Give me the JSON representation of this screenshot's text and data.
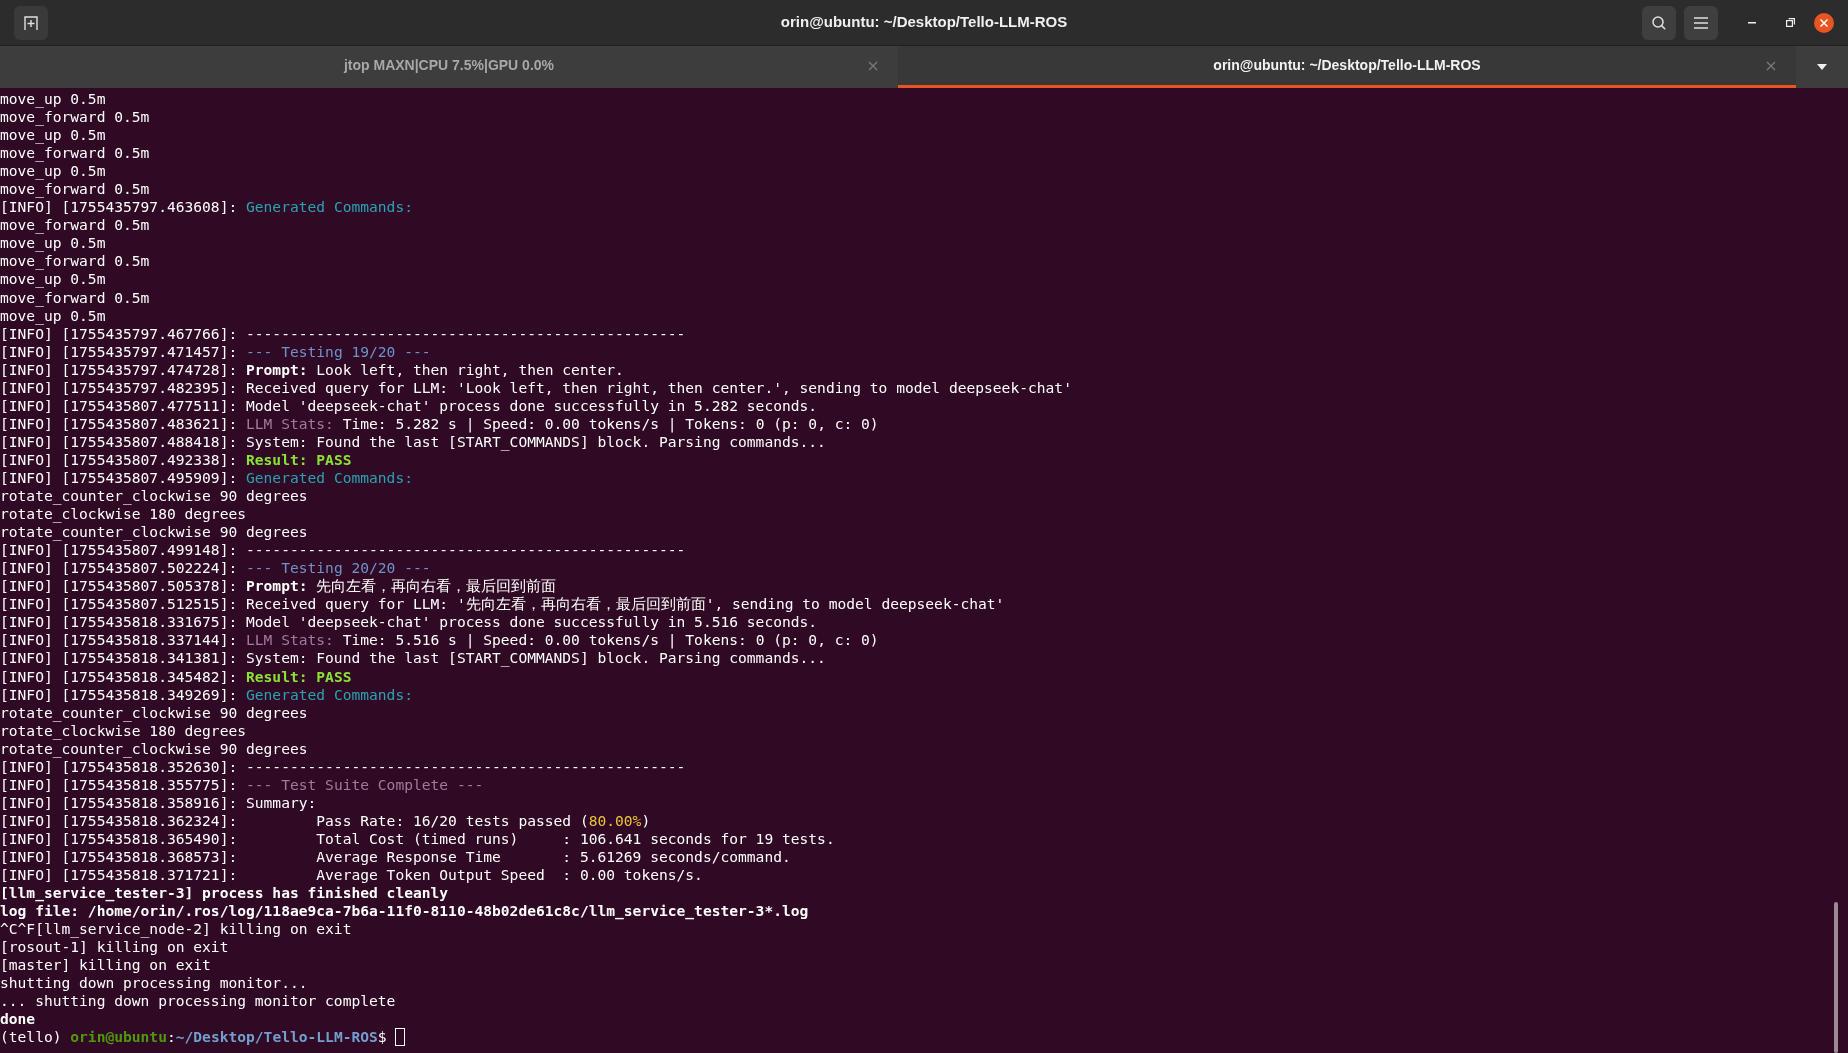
{
  "window": {
    "title": "orin@ubuntu: ~/Desktop/Tello-LLM-ROS"
  },
  "tabs": [
    {
      "label": "jtop MAXN|CPU 7.5%|GPU 0.0%",
      "selected": false
    },
    {
      "label": "orin@ubuntu: ~/Desktop/Tello-LLM-ROS",
      "selected": true
    }
  ],
  "terminal": {
    "lines": [
      [
        {
          "kind": "plain",
          "text": "move_up 0.5m"
        }
      ],
      [
        {
          "kind": "plain",
          "text": "move_forward 0.5m"
        }
      ],
      [
        {
          "kind": "plain",
          "text": "move_up 0.5m"
        }
      ],
      [
        {
          "kind": "plain",
          "text": "move_forward 0.5m"
        }
      ],
      [
        {
          "kind": "plain",
          "text": "move_up 0.5m"
        }
      ],
      [
        {
          "kind": "plain",
          "text": "move_forward 0.5m"
        }
      ],
      [
        {
          "kind": "plain",
          "text": "[INFO] [1755435797.463608]: "
        },
        {
          "kind": "cyan",
          "text": "Generated Commands:"
        }
      ],
      [
        {
          "kind": "plain",
          "text": "move_forward 0.5m"
        }
      ],
      [
        {
          "kind": "plain",
          "text": "move_up 0.5m"
        }
      ],
      [
        {
          "kind": "plain",
          "text": "move_forward 0.5m"
        }
      ],
      [
        {
          "kind": "plain",
          "text": "move_up 0.5m"
        }
      ],
      [
        {
          "kind": "plain",
          "text": "move_forward 0.5m"
        }
      ],
      [
        {
          "kind": "plain",
          "text": "move_up 0.5m"
        }
      ],
      [
        {
          "kind": "plain",
          "text": "[INFO] [1755435797.467766]: --------------------------------------------------"
        }
      ],
      [
        {
          "kind": "plain",
          "text": "[INFO] [1755435797.471457]: "
        },
        {
          "kind": "blue",
          "text": "--- Testing 19/20 ---"
        }
      ],
      [
        {
          "kind": "plain",
          "text": "[INFO] [1755435797.474728]: "
        },
        {
          "kind": "bold",
          "text": "Prompt:"
        },
        {
          "kind": "plain",
          "text": " Look left, then right, then center."
        }
      ],
      [
        {
          "kind": "plain",
          "text": "[INFO] [1755435797.482395]: Received query for LLM: 'Look left, then right, then center.', sending to model deepseek-chat'"
        }
      ],
      [
        {
          "kind": "plain",
          "text": "[INFO] [1755435807.477511]: Model 'deepseek-chat' process done successfully in 5.282 seconds."
        }
      ],
      [
        {
          "kind": "plain",
          "text": "[INFO] [1755435807.483621]: "
        },
        {
          "kind": "mauve",
          "text": "LLM Stats:"
        },
        {
          "kind": "plain",
          "text": " Time: 5.282 s | Speed: 0.00 tokens/s | Tokens: 0 (p: 0, c: 0)"
        }
      ],
      [
        {
          "kind": "plain",
          "text": "[INFO] [1755435807.488418]: System: Found the last [START_COMMANDS] block. Parsing commands..."
        }
      ],
      [
        {
          "kind": "plain",
          "text": "[INFO] [1755435807.492338]: "
        },
        {
          "kind": "green",
          "text": "Result: PASS"
        }
      ],
      [
        {
          "kind": "plain",
          "text": "[INFO] [1755435807.495909]: "
        },
        {
          "kind": "cyan",
          "text": "Generated Commands:"
        }
      ],
      [
        {
          "kind": "plain",
          "text": "rotate_counter_clockwise 90 degrees"
        }
      ],
      [
        {
          "kind": "plain",
          "text": "rotate_clockwise 180 degrees"
        }
      ],
      [
        {
          "kind": "plain",
          "text": "rotate_counter_clockwise 90 degrees"
        }
      ],
      [
        {
          "kind": "plain",
          "text": "[INFO] [1755435807.499148]: --------------------------------------------------"
        }
      ],
      [
        {
          "kind": "plain",
          "text": "[INFO] [1755435807.502224]: "
        },
        {
          "kind": "blue",
          "text": "--- Testing 20/20 ---"
        }
      ],
      [
        {
          "kind": "plain",
          "text": "[INFO] [1755435807.505378]: "
        },
        {
          "kind": "bold",
          "text": "Prompt:"
        },
        {
          "kind": "plain",
          "text": " 先向左看，再向右看，最后回到前面"
        }
      ],
      [
        {
          "kind": "plain",
          "text": "[INFO] [1755435807.512515]: Received query for LLM: '先向左看，再向右看，最后回到前面', sending to model deepseek-chat'"
        }
      ],
      [
        {
          "kind": "plain",
          "text": "[INFO] [1755435818.331675]: Model 'deepseek-chat' process done successfully in 5.516 seconds."
        }
      ],
      [
        {
          "kind": "plain",
          "text": "[INFO] [1755435818.337144]: "
        },
        {
          "kind": "mauve",
          "text": "LLM Stats:"
        },
        {
          "kind": "plain",
          "text": " Time: 5.516 s | Speed: 0.00 tokens/s | Tokens: 0 (p: 0, c: 0)"
        }
      ],
      [
        {
          "kind": "plain",
          "text": "[INFO] [1755435818.341381]: System: Found the last [START_COMMANDS] block. Parsing commands..."
        }
      ],
      [
        {
          "kind": "plain",
          "text": "[INFO] [1755435818.345482]: "
        },
        {
          "kind": "green",
          "text": "Result: PASS"
        }
      ],
      [
        {
          "kind": "plain",
          "text": "[INFO] [1755435818.349269]: "
        },
        {
          "kind": "cyan",
          "text": "Generated Commands:"
        }
      ],
      [
        {
          "kind": "plain",
          "text": "rotate_counter_clockwise 90 degrees"
        }
      ],
      [
        {
          "kind": "plain",
          "text": "rotate_clockwise 180 degrees"
        }
      ],
      [
        {
          "kind": "plain",
          "text": "rotate_counter_clockwise 90 degrees"
        }
      ],
      [
        {
          "kind": "plain",
          "text": "[INFO] [1755435818.352630]: --------------------------------------------------"
        }
      ],
      [
        {
          "kind": "plain",
          "text": "[INFO] [1755435818.355775]: "
        },
        {
          "kind": "mauve",
          "text": "--- Test Suite Complete ---"
        }
      ],
      [
        {
          "kind": "plain",
          "text": "[INFO] [1755435818.358916]: Summary:"
        }
      ],
      [
        {
          "kind": "plain",
          "text": "[INFO] [1755435818.362324]:         Pass Rate: 16/20 tests passed ("
        },
        {
          "kind": "yellow",
          "text": "80.00%"
        },
        {
          "kind": "plain",
          "text": ")"
        }
      ],
      [
        {
          "kind": "plain",
          "text": "[INFO] [1755435818.365490]:         Total Cost (timed runs)     : 106.641 seconds for 19 tests."
        }
      ],
      [
        {
          "kind": "plain",
          "text": "[INFO] [1755435818.368573]:         Average Response Time       : 5.61269 seconds/command."
        }
      ],
      [
        {
          "kind": "plain",
          "text": "[INFO] [1755435818.371721]:         Average Token Output Speed  : 0.00 tokens/s."
        }
      ],
      [
        {
          "kind": "bold",
          "text": "[llm_service_tester-3] process has finished cleanly"
        }
      ],
      [
        {
          "kind": "bold",
          "text": "log file: /home/orin/.ros/log/118ae9ca-7b6a-11f0-8110-48b02de61c8c/llm_service_tester-3*.log"
        }
      ],
      [
        {
          "kind": "plain",
          "text": "^C^F[llm_service_node-2] killing on exit"
        }
      ],
      [
        {
          "kind": "plain",
          "text": "[rosout-1] killing on exit"
        }
      ],
      [
        {
          "kind": "plain",
          "text": "[master] killing on exit"
        }
      ],
      [
        {
          "kind": "plain",
          "text": "shutting down processing monitor..."
        }
      ],
      [
        {
          "kind": "plain",
          "text": "... shutting down processing monitor complete"
        }
      ],
      [
        {
          "kind": "bold",
          "text": "done"
        }
      ]
    ],
    "prompt": [
      {
        "kind": "plain",
        "text": "(tello) "
      },
      {
        "kind": "user",
        "text": "orin@ubuntu"
      },
      {
        "kind": "plain",
        "text": ":"
      },
      {
        "kind": "path",
        "text": "~/Desktop/Tello-LLM-ROS"
      },
      {
        "kind": "plain",
        "text": "$ "
      }
    ]
  }
}
